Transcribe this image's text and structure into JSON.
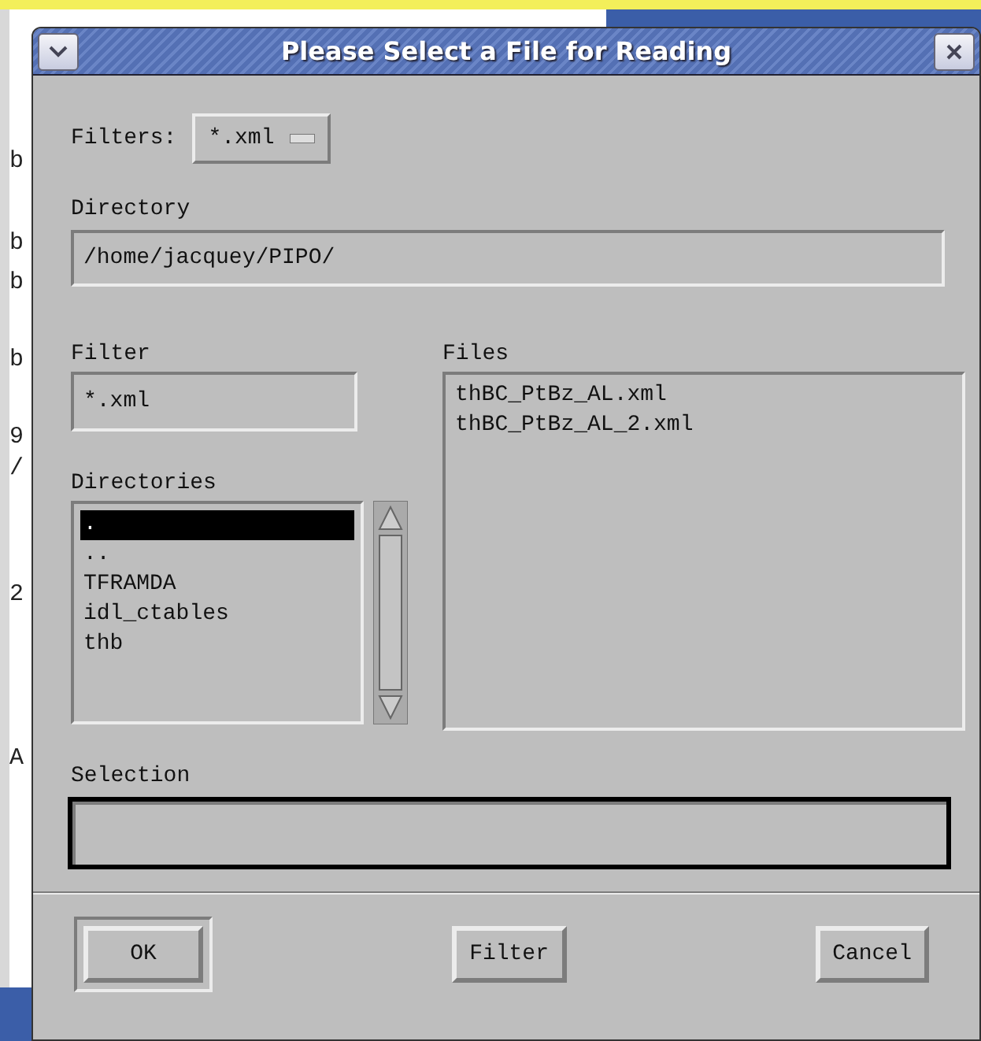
{
  "background_window": {
    "fragments": [
      "b",
      "b",
      "b",
      "b",
      "9",
      "/",
      "2",
      "A"
    ]
  },
  "dialog": {
    "title": "Please Select a File for Reading"
  },
  "filters": {
    "label": "Filters:",
    "value": "*.xml"
  },
  "directory": {
    "label": "Directory",
    "value": "/home/jacquey/PIPO/"
  },
  "filter": {
    "label": "Filter",
    "value": "*.xml"
  },
  "directories": {
    "label": "Directories",
    "items": [
      {
        "name": ".",
        "selected": true
      },
      {
        "name": "..",
        "selected": false
      },
      {
        "name": "TFRAMDA",
        "selected": false
      },
      {
        "name": "idl_ctables",
        "selected": false
      },
      {
        "name": "thb",
        "selected": false
      }
    ]
  },
  "files": {
    "label": "Files",
    "items": [
      {
        "name": "thBC_PtBz_AL.xml",
        "selected": false
      },
      {
        "name": "thBC_PtBz_AL_2.xml",
        "selected": false
      }
    ]
  },
  "selection": {
    "label": "Selection",
    "focused": true
  },
  "buttons": [
    {
      "label": "OK",
      "default": true
    },
    {
      "label": "Filter",
      "default": false
    },
    {
      "label": "Cancel",
      "default": false
    }
  ]
}
